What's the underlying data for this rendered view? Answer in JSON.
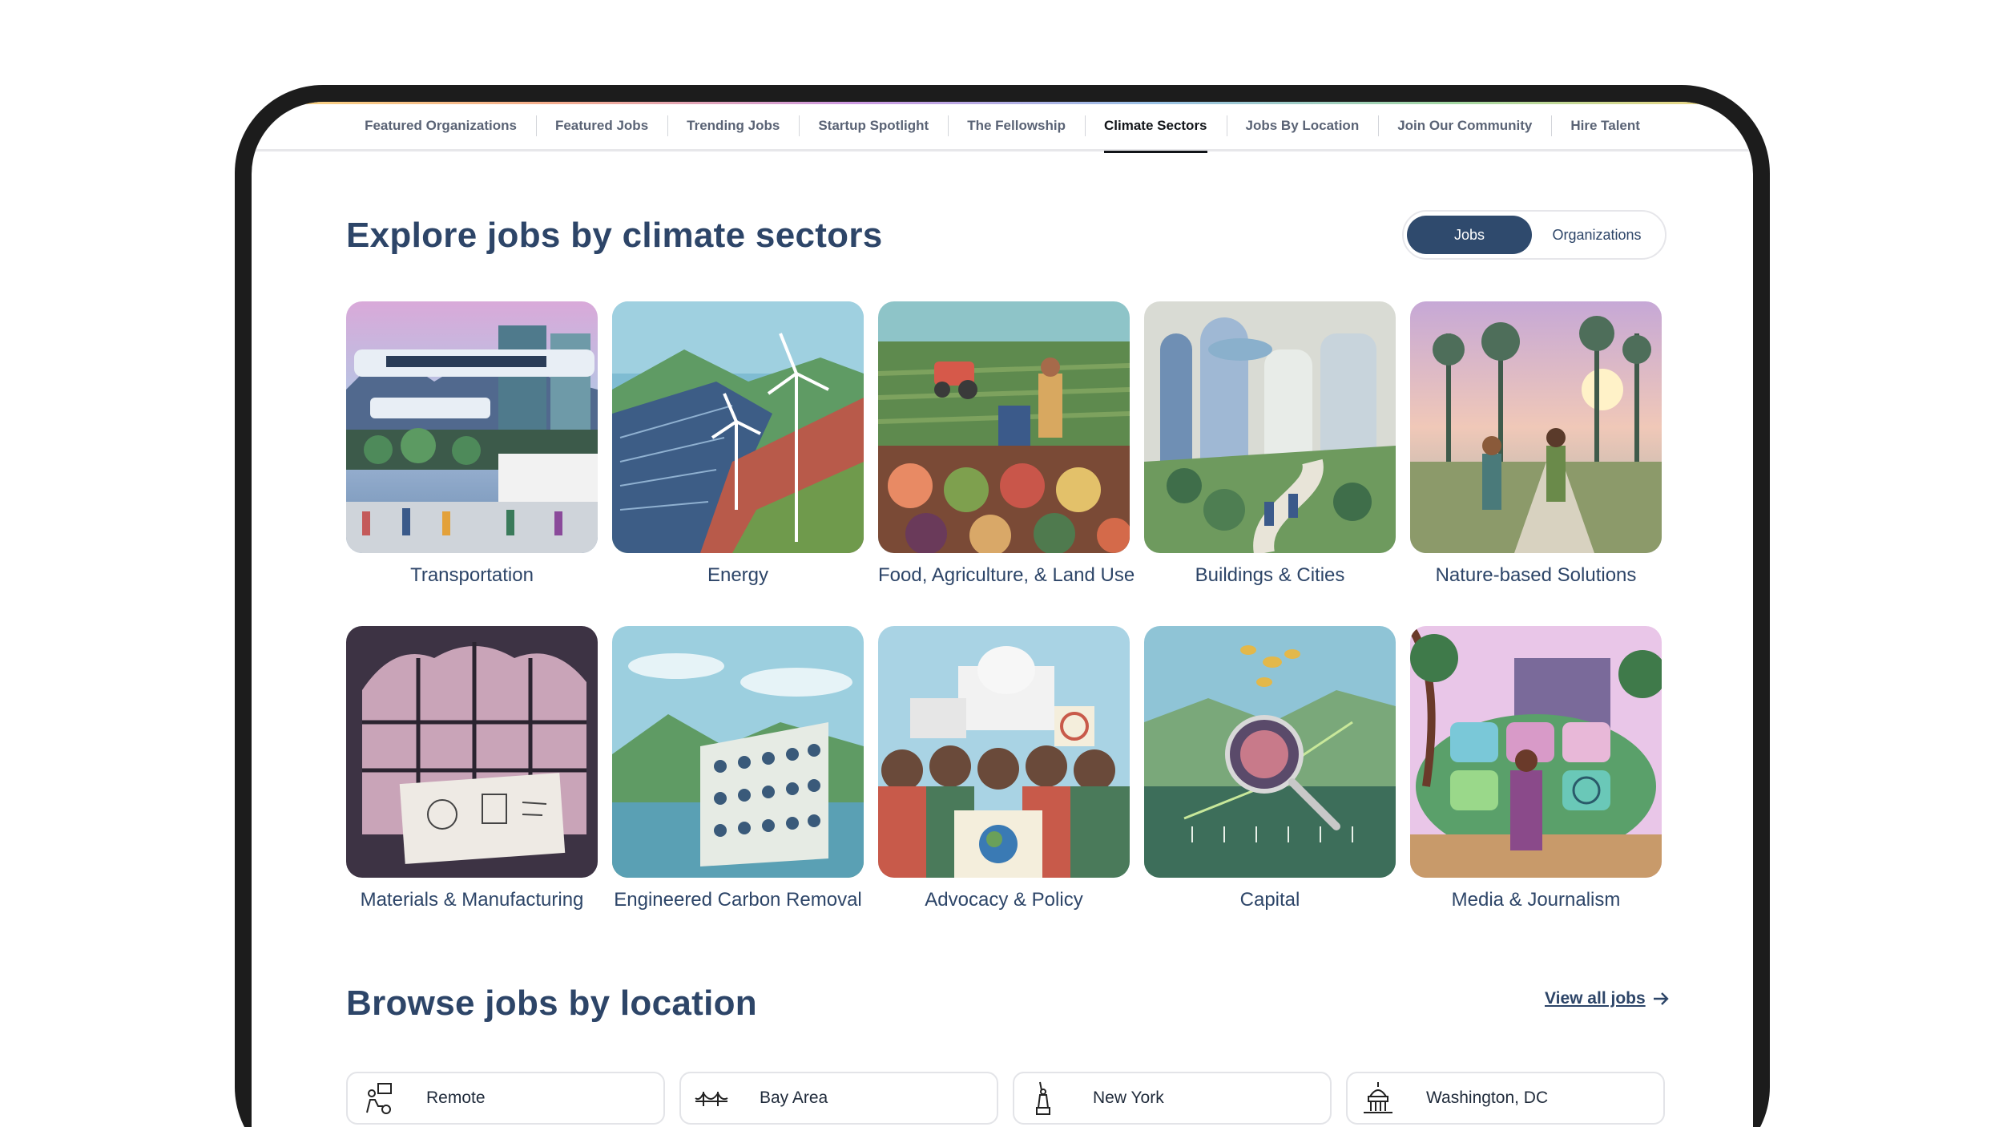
{
  "nav": {
    "items": [
      {
        "label": "Featured Organizations"
      },
      {
        "label": "Featured Jobs"
      },
      {
        "label": "Trending Jobs"
      },
      {
        "label": "Startup Spotlight"
      },
      {
        "label": "The Fellowship"
      },
      {
        "label": "Climate Sectors",
        "active": true
      },
      {
        "label": "Jobs By Location"
      },
      {
        "label": "Join Our Community"
      },
      {
        "label": "Hire Talent"
      }
    ]
  },
  "sectors_section": {
    "title": "Explore jobs by climate sectors",
    "toggle": {
      "jobs_label": "Jobs",
      "organizations_label": "Organizations",
      "selected": "Jobs"
    },
    "sectors": [
      {
        "label": "Transportation",
        "icon": "transportation-illustration"
      },
      {
        "label": "Energy",
        "icon": "energy-illustration"
      },
      {
        "label": "Food, Agriculture, & Land Use",
        "icon": "food-agriculture-illustration"
      },
      {
        "label": "Buildings & Cities",
        "icon": "buildings-cities-illustration"
      },
      {
        "label": "Nature-based Solutions",
        "icon": "nature-solutions-illustration"
      },
      {
        "label": "Materials & Manufacturing",
        "icon": "materials-manufacturing-illustration"
      },
      {
        "label": "Engineered Carbon Removal",
        "icon": "carbon-removal-illustration"
      },
      {
        "label": "Advocacy & Policy",
        "icon": "advocacy-policy-illustration"
      },
      {
        "label": "Capital",
        "icon": "capital-illustration"
      },
      {
        "label": "Media & Journalism",
        "icon": "media-journalism-illustration"
      }
    ]
  },
  "location_section": {
    "title": "Browse jobs by location",
    "view_all_label": "View all jobs",
    "locations": [
      {
        "label": "Remote",
        "icon": "remote-worker-icon"
      },
      {
        "label": "Bay Area",
        "icon": "golden-gate-bridge-icon"
      },
      {
        "label": "New York",
        "icon": "statue-of-liberty-icon"
      },
      {
        "label": "Washington, DC",
        "icon": "capitol-building-icon"
      }
    ]
  },
  "colors": {
    "heading": "#2d4568",
    "toggle_active": "#2f4a6d",
    "frame": "#1c1c1c"
  }
}
